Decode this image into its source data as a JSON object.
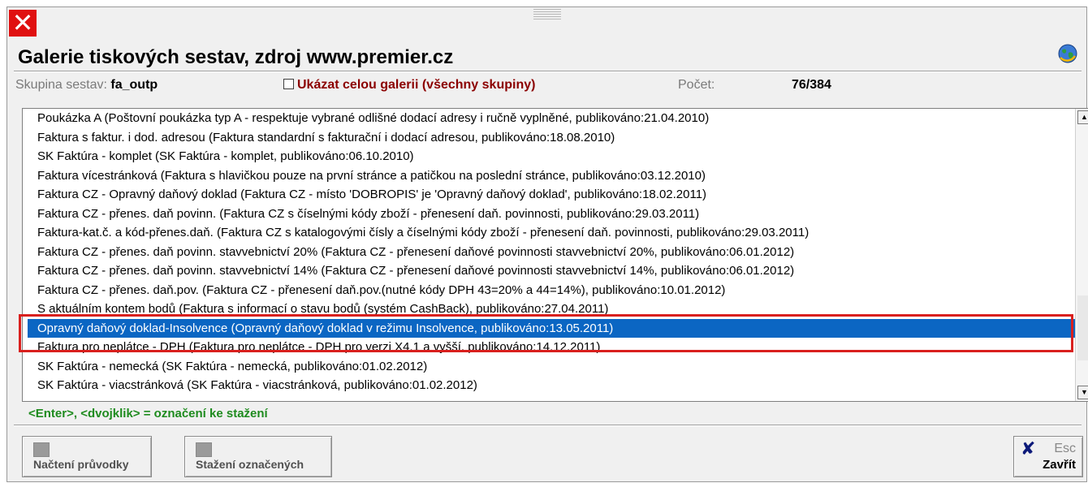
{
  "window": {
    "title": "Galerie tiskových sestav, zdroj www.premier.cz",
    "close_icon": "close-x-icon",
    "globe_icon": "globe-icon"
  },
  "info": {
    "group_label": "Skupina sestav:",
    "group_value": "fa_outp",
    "show_all_label": "Ukázat celou galerii (všechny skupiny)",
    "show_all_checked": false,
    "count_label": "Počet:",
    "count_value": "76/384"
  },
  "list": {
    "items": [
      "Poukázka A  (Poštovní poukázka typ A - respektuje vybrané odlišné dodací adresy i ručně vyplněné, publikováno:21.04.2010)",
      "Faktura s faktur. i dod. adresou  (Faktura standardní s fakturační i dodací adresou, publikováno:18.08.2010)",
      "SK Faktúra - komplet  (SK Faktúra - komplet, publikováno:06.10.2010)",
      "Faktura vícestránková  (Faktura s hlavičkou pouze na první stránce a patičkou na poslední stránce, publikováno:03.12.2010)",
      "Faktura CZ - Opravný daňový doklad  (Faktura CZ - místo 'DOBROPIS' je 'Opravný daňový doklad', publikováno:18.02.2011)",
      "Faktura CZ - přenes. daň povinn.  (Faktura CZ s číselnými kódy zboží - přenesení daň. povinnosti, publikováno:29.03.2011)",
      "Faktura-kat.č. a kód-přenes.daň.  (Faktura CZ s katalogovými čísly a číselnými kódy zboží - přenesení daň. povinnosti, publikováno:29.03.2011)",
      "Faktura CZ - přenes. daň povinn. stavvebnictví 20%  (Faktura CZ - přenesení daňové povinnosti stavvebnictví 20%, publikováno:06.01.2012)",
      "Faktura CZ - přenes. daň povinn. stavvebnictví 14%  (Faktura CZ - přenesení daňové povinnosti stavvebnictví 14%, publikováno:06.01.2012)",
      "Faktura CZ - přenes. daň.pov.  (Faktura CZ - přenesení daň.pov.(nutné kódy DPH 43=20% a 44=14%), publikováno:10.01.2012)",
      "S aktuálním kontem bodů  (Faktura s informací o stavu bodů (systém CashBack), publikováno:27.04.2011)",
      "Opravný daňový doklad-Insolvence  (Opravný daňový doklad v režimu Insolvence, publikováno:13.05.2011)",
      "Faktura pro neplátce - DPH  (Faktura pro neplátce - DPH pro verzi X4.1 a vyšší, publikováno:14.12.2011)",
      "SK Faktúra - nemecká  (SK Faktúra - nemecká, publikováno:01.02.2012)",
      "SK Faktúra - viacstránková  (SK Faktúra - viacstránková, publikováno:01.02.2012)"
    ],
    "selected_index": 11,
    "scroll_up_icon": "arrow-up-icon",
    "scroll_down_icon": "arrow-down-icon"
  },
  "hint": "<Enter>, <dvojklik> = označení ke stažení",
  "buttons": {
    "load_label": "Načtení průvodky",
    "download_label": "Stažení označených",
    "close_key": "Esc",
    "close_label": "Zavřít"
  },
  "colors": {
    "selection": "#0b66c3",
    "highlight_frame": "#d9201e",
    "hint_text": "#1e8b1e",
    "checkbox_label": "#8b0000"
  }
}
